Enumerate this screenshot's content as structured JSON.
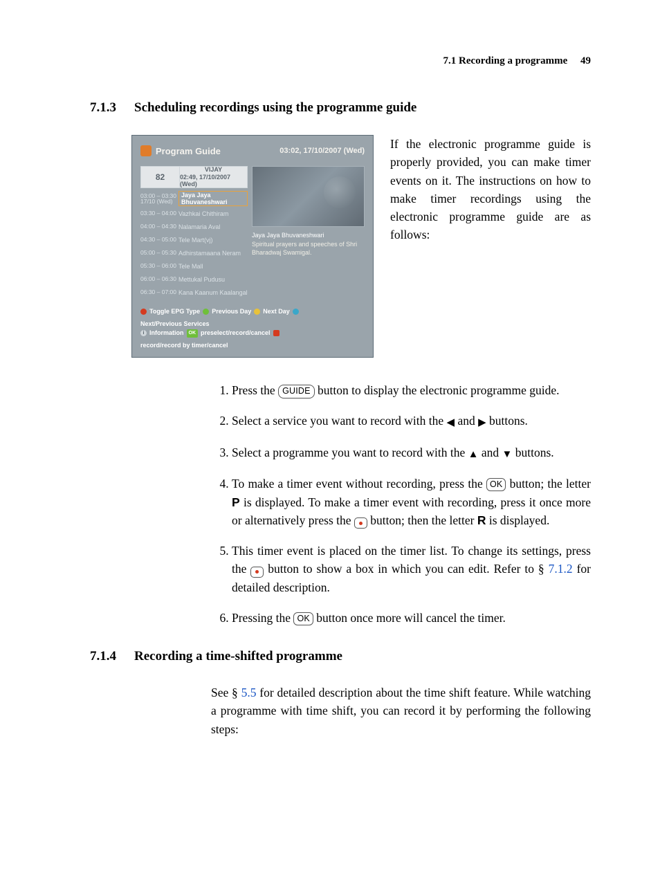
{
  "runningHead": {
    "section": "7.1 Recording a programme",
    "page": "49"
  },
  "sec713": {
    "num": "7.1.3",
    "title": "Scheduling recordings using the programme guide",
    "intro": "If the electronic programme guide is properly provided, you can make timer events on it. The instructions on how to make timer recordings using the electronic programme guide are as follows:"
  },
  "pg": {
    "title": "Program Guide",
    "headerDate": "03:02, 17/10/2007 (Wed)",
    "channelNumber": "82",
    "currentService": "VIJAY",
    "currentTime": "02:49, 17/10/2007 (Wed)",
    "rows": [
      {
        "time": "03:00 – 03:30\n17/10 (Wed)",
        "title": "Jaya Jaya Bhuvaneshwari",
        "hl": true
      },
      {
        "time": "03:30 – 04:00",
        "title": "Vazhkai Chithiram"
      },
      {
        "time": "04:00 – 04:30",
        "title": "Nalamaria Aval"
      },
      {
        "time": "04:30 – 05:00",
        "title": "Tele Mart(vj)"
      },
      {
        "time": "05:00 – 05:30",
        "title": "Adhirstamaana Neram"
      },
      {
        "time": "05:30 – 06:00",
        "title": "Tele Mall"
      },
      {
        "time": "06:00 – 06:30",
        "title": "Mettukal Pudusu"
      },
      {
        "time": "06:30 – 07:00",
        "title": "Kana Kaanum Kaalangal"
      }
    ],
    "metaTitle": "Jaya Jaya Bhuvaneshwari",
    "metaDesc": "Spiritual prayers and speeches of Shri Bharadwaj Swamigal.",
    "footer": {
      "toggle": "Toggle EPG Type",
      "prev": "Previous Day",
      "next": "Next Day",
      "npServices": "Next/Previous Services",
      "info": "Information",
      "ok": "OK",
      "preselect": "preselect/record/cancel",
      "rec": "record/record by timer/cancel"
    }
  },
  "steps": {
    "s1a": "Press the ",
    "guide": "GUIDE",
    "s1b": " button to display the electronic programme guide.",
    "s2a": "Select a service you want to record with the ",
    "left": "◀",
    "and": " and ",
    "right": "▶",
    "buttons": " buttons.",
    "s3a": "Select a programme you want to record with the ",
    "up": "▲",
    "down": "▼",
    "s4a": "To make a timer event without recording, press the ",
    "ok": "OK",
    "s4b": " button; the letter ",
    "P": "P",
    "s4c": " is displayed. To make a timer event with recording, press it once more or alternatively press the ",
    "s4d": " button; then the letter ",
    "R": "R",
    "s4e": " is displayed.",
    "s5a": "This timer event is placed on the timer list. To change its settings, press the ",
    "s5b": " button to show a box in which you can edit. Refer to § ",
    "ref712": "7.1.2",
    "s5c": " for detailed description.",
    "s6a": "Pressing the ",
    "s6b": " button once more will cancel the timer."
  },
  "sec714": {
    "num": "7.1.4",
    "title": "Recording a time-shifted programme",
    "bodyA": "See § ",
    "ref55": "5.5",
    "bodyB": " for detailed description about the time shift feature. While watching a programme with time shift, you can record it by performing the following steps:"
  }
}
